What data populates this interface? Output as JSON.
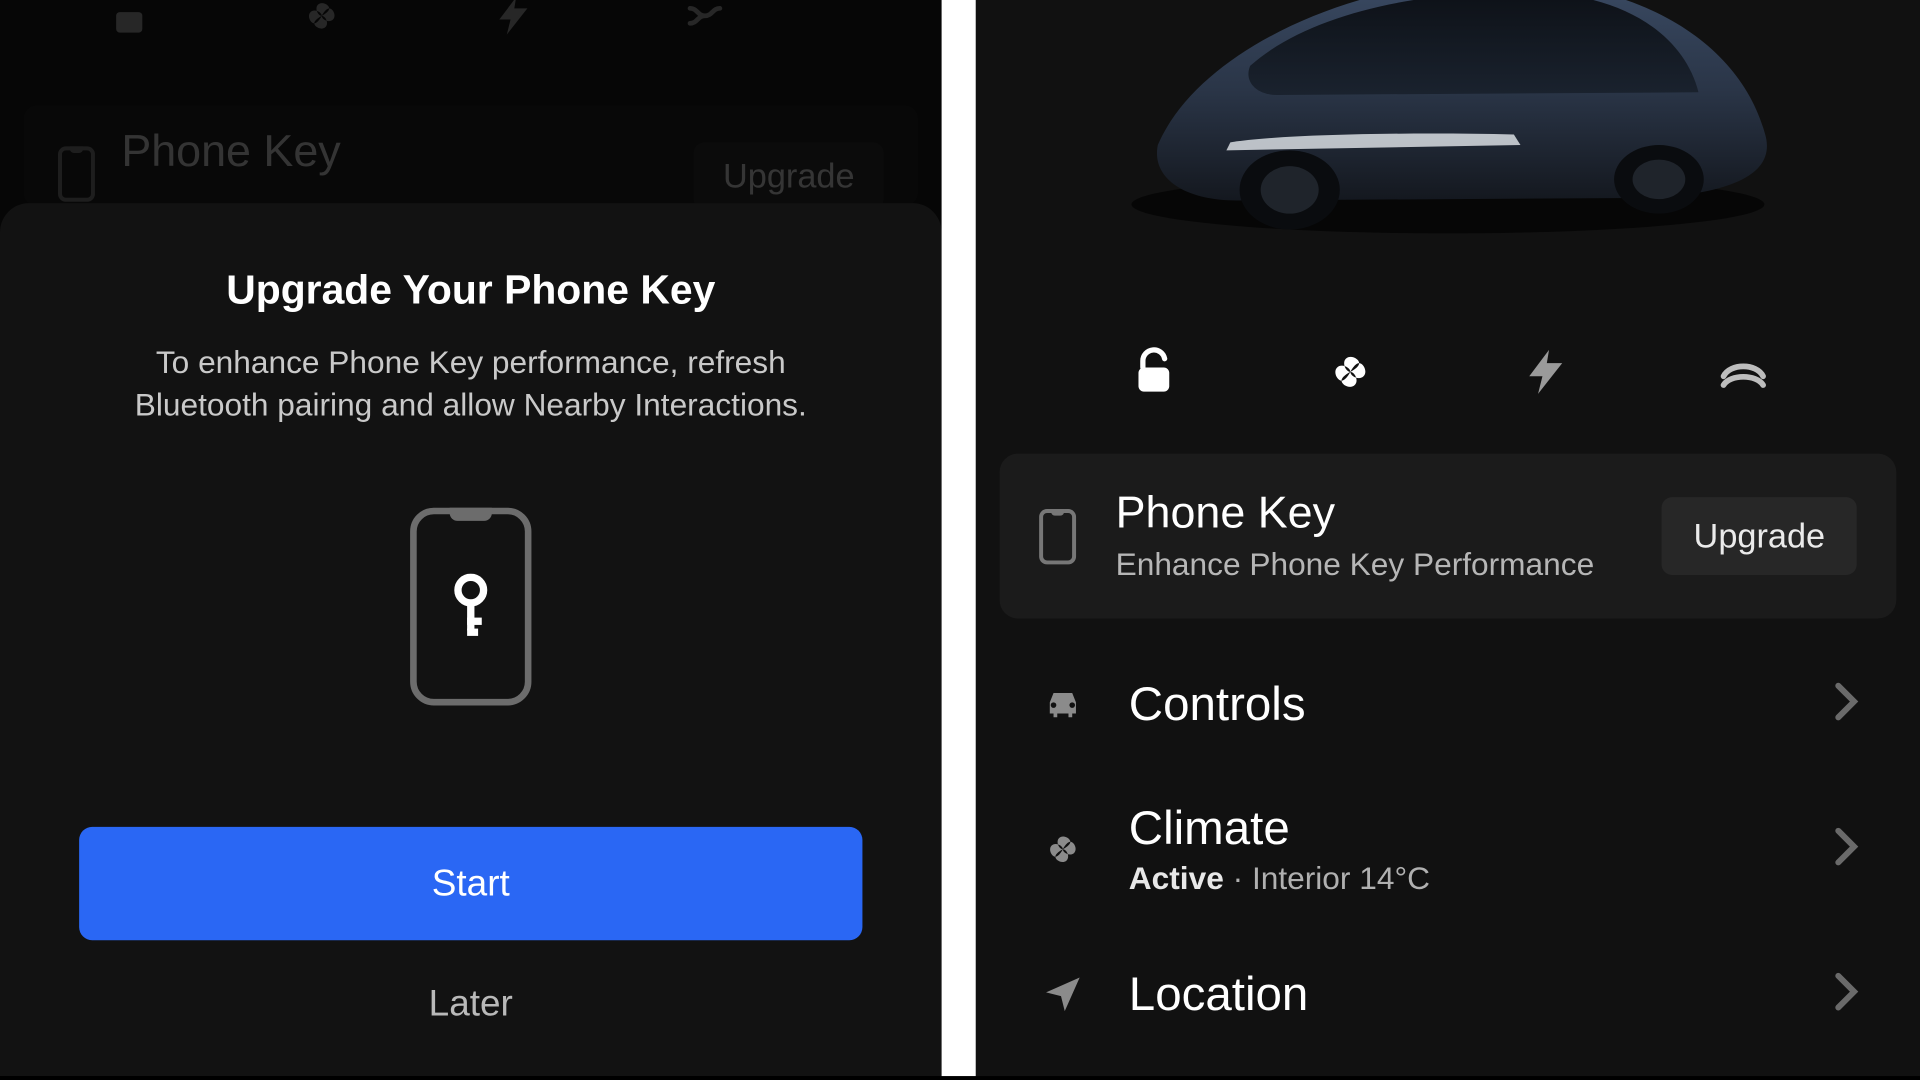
{
  "left": {
    "card": {
      "title": "Phone Key",
      "upgrade": "Upgrade"
    },
    "modal": {
      "title": "Upgrade Your Phone Key",
      "body": "To enhance Phone Key performance, refresh Bluetooth pairing and allow Nearby Interactions.",
      "start": "Start",
      "later": "Later"
    }
  },
  "right": {
    "phonekey": {
      "title": "Phone Key",
      "subtitle": "Enhance Phone Key Performance",
      "button": "Upgrade"
    },
    "menu": {
      "controls": "Controls",
      "climate": {
        "label": "Climate",
        "status": "Active",
        "sep": " · ",
        "detail": "Interior 14°C"
      },
      "location": "Location"
    }
  }
}
